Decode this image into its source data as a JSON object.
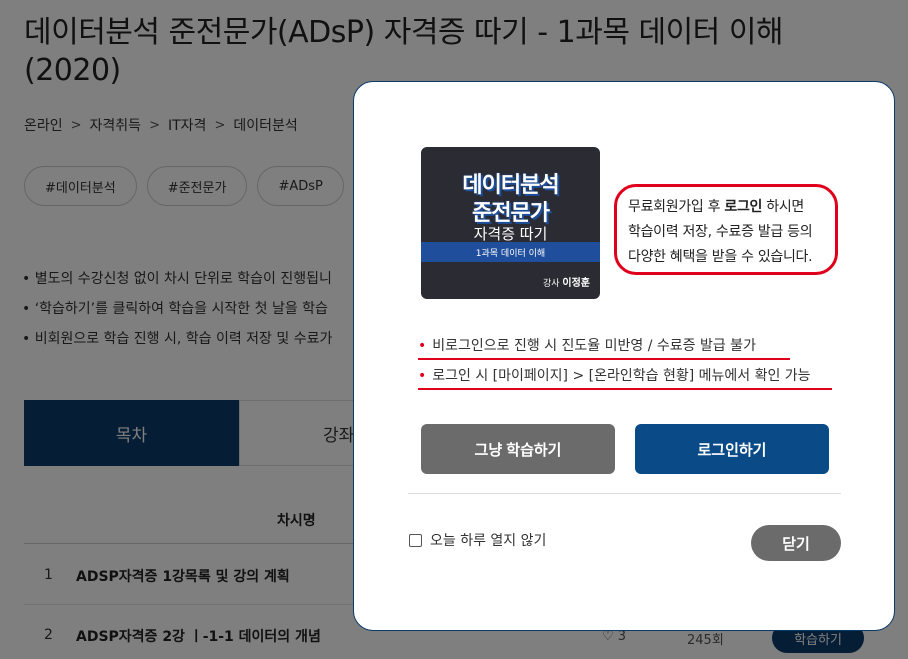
{
  "page": {
    "title": "데이터분석 준전문가(ADsP) 자격증 따기 - 1과목 데이터 이해 (2020)",
    "breadcrumb": [
      "온라인",
      "자격취득",
      "IT자격",
      "데이터분석"
    ],
    "tags": [
      "#데이터분석",
      "#준전문가",
      "#ADsP"
    ],
    "notes": [
      "• 별도의 수강신청 없이 차시 단위로 학습이 진행됩니",
      "• ‘학습하기’를 클릭하여 학습을 시작한 첫 날을 학습",
      "• 비회원으로 학습 진행 시, 학습 이력 저장 및 수료가"
    ],
    "tabs": [
      "목차",
      "강좌정"
    ],
    "table_header": "차시명",
    "rows": [
      {
        "num": "1",
        "name": "ADSP자격증 1강목록 및 강의 계획"
      },
      {
        "num": "2",
        "name": "ADSP자격증 2강 ㅣ-1-1 데이터의 개념",
        "likes": "♡ 3",
        "views": "245회",
        "action": "학습하기"
      }
    ]
  },
  "modal": {
    "thumbnail": {
      "line1": "데이터분석",
      "line2": "준전문가",
      "line3": "자격증 따기",
      "band": "1과목 데이터 이해",
      "instructor_prefix": "강사",
      "instructor": "이정훈"
    },
    "callout": {
      "part1": "무료회원가입 후 ",
      "bold": "로그인",
      "part2": " 하시면",
      "line2": "학습이력 저장, 수료증 발급 등의",
      "line3": "다양한 혜택을 받을 수 있습니다."
    },
    "bullets": [
      "비로그인으로 진행 시 진도율 미반영 / 수료증 발급 불가",
      "로그인 시 [마이페이지] > [온라인학습 현황] 메뉴에서 확인 가능"
    ],
    "btn_just_study": "그냥 학습하기",
    "btn_login": "로그인하기",
    "dont_show_today": "오늘 하루 열지 않기",
    "btn_close": "닫기"
  },
  "colors": {
    "primary": "#0a4a86",
    "accent_red": "#e0001b",
    "gray_button": "#6b6b6b"
  }
}
